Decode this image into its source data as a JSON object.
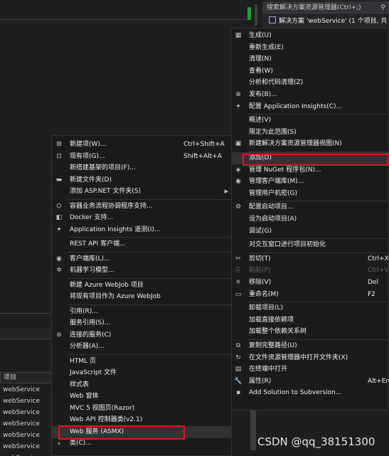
{
  "solution_explorer": {
    "search_placeholder": "搜索解决方案资源管理器(Ctrl+;)",
    "search_icon": "search-icon",
    "solution_label": "解决方案 'webService' (1 个项目, 共"
  },
  "grid": {
    "header": "项目",
    "rows": [
      "webService",
      "webService",
      "webService",
      "webService",
      "webService",
      "webService",
      "webService"
    ]
  },
  "right_menu": {
    "items": [
      {
        "icon": "▦",
        "label": "生成(U)",
        "shortcut": ""
      },
      {
        "icon": "",
        "label": "重新生成(E)",
        "shortcut": ""
      },
      {
        "icon": "",
        "label": "清理(N)",
        "shortcut": ""
      },
      {
        "icon": "",
        "label": "查看(W)",
        "shortcut": ""
      },
      {
        "icon": "",
        "label": "分析和代码清理(Z)",
        "shortcut": ""
      },
      {
        "icon": "⊕",
        "label": "发布(B)...",
        "shortcut": ""
      },
      {
        "icon": "✦",
        "label": "配置 Application Insights(C)...",
        "shortcut": ""
      },
      {
        "icon": "",
        "label": "概述(V)",
        "shortcut": ""
      },
      {
        "icon": "",
        "label": "限定为此范围(S)",
        "shortcut": ""
      },
      {
        "icon": "▣",
        "label": "新建解决方案资源管理器视图(N)",
        "shortcut": ""
      },
      {
        "icon": "",
        "label": "添加(D)",
        "shortcut": ""
      },
      {
        "icon": "◈",
        "label": "管理 NuGet 程序包(N)...",
        "shortcut": ""
      },
      {
        "icon": "◉",
        "label": "管理客户端库(M)...",
        "shortcut": ""
      },
      {
        "icon": "",
        "label": "管理用户机密(G)",
        "shortcut": ""
      },
      {
        "icon": "⚙",
        "label": "配置启动项目...",
        "shortcut": ""
      },
      {
        "icon": "",
        "label": "设为启动项目(A)",
        "shortcut": ""
      },
      {
        "icon": "",
        "label": "调试(G)",
        "shortcut": ""
      },
      {
        "icon": "",
        "label": "对交互窗口进行项目初始化",
        "shortcut": ""
      },
      {
        "icon": "✂",
        "label": "剪切(T)",
        "shortcut": "Ctrl+X"
      },
      {
        "icon": "⎘",
        "label": "粘贴(P)",
        "shortcut": "Ctrl+V"
      },
      {
        "icon": "✕",
        "label": "移除(V)",
        "shortcut": "Del"
      },
      {
        "icon": "▭",
        "label": "重命名(M)",
        "shortcut": "F2"
      },
      {
        "icon": "",
        "label": "卸载项目(L)",
        "shortcut": ""
      },
      {
        "icon": "",
        "label": "加载直接依赖项",
        "shortcut": ""
      },
      {
        "icon": "",
        "label": "加载整个依赖关系树",
        "shortcut": ""
      },
      {
        "icon": "⧉",
        "label": "复制完整路径(U)",
        "shortcut": ""
      },
      {
        "icon": "↻",
        "label": "在文件资源管理器中打开文件夹(X)",
        "shortcut": ""
      },
      {
        "icon": "▤",
        "label": "在终端中打开",
        "shortcut": ""
      },
      {
        "icon": "🔧",
        "label": "属性(R)",
        "shortcut": "Alt+Ent"
      },
      {
        "icon": "▪",
        "label": "Add Solution to Subversion...",
        "shortcut": ""
      }
    ]
  },
  "add_submenu": {
    "items": [
      {
        "icon": "⊞",
        "label": "新建项(W)...",
        "shortcut": "Ctrl+Shift+A"
      },
      {
        "icon": "⊡",
        "label": "现有项(G)...",
        "shortcut": "Shift+Alt+A"
      },
      {
        "icon": "",
        "label": "新搭建基架的项目(F)...",
        "shortcut": ""
      },
      {
        "icon": "▬",
        "label": "新建文件夹(D)",
        "shortcut": ""
      },
      {
        "icon": "",
        "label": "添加 ASP.NET 文件夹(S)",
        "shortcut": ""
      },
      {
        "icon": "⛭",
        "label": "容器业务流程协调程序支持...",
        "shortcut": ""
      },
      {
        "icon": "◧",
        "label": "Docker 支持...",
        "shortcut": ""
      },
      {
        "icon": "✦",
        "label": "Application Insights 遥测(I)...",
        "shortcut": ""
      },
      {
        "icon": "",
        "label": "REST API 客户端...",
        "shortcut": ""
      },
      {
        "icon": "◉",
        "label": "客户端库(L)...",
        "shortcut": ""
      },
      {
        "icon": "✲",
        "label": "机器学习模型...",
        "shortcut": ""
      },
      {
        "icon": "",
        "label": "新建 Azure WebJob 项目",
        "shortcut": ""
      },
      {
        "icon": "",
        "label": "将现有项目作为 Azure WebJob",
        "shortcut": ""
      },
      {
        "icon": "",
        "label": "引用(R)...",
        "shortcut": ""
      },
      {
        "icon": "",
        "label": "服务引用(S)...",
        "shortcut": ""
      },
      {
        "icon": "⊛",
        "label": "连接的服务(C)",
        "shortcut": ""
      },
      {
        "icon": "",
        "label": "分析器(A)...",
        "shortcut": ""
      },
      {
        "icon": "",
        "label": "HTML 页",
        "shortcut": ""
      },
      {
        "icon": "",
        "label": "JavaScript 文件",
        "shortcut": ""
      },
      {
        "icon": "",
        "label": "样式表",
        "shortcut": ""
      },
      {
        "icon": "",
        "label": "Web 窗体",
        "shortcut": ""
      },
      {
        "icon": "",
        "label": "MVC 5 视图页(Razor)",
        "shortcut": ""
      },
      {
        "icon": "",
        "label": "Web API 控制器类(v2.1)",
        "shortcut": ""
      },
      {
        "icon": "",
        "label": "Web 服务 (ASMX)",
        "shortcut": ""
      },
      {
        "icon": "⁎",
        "label": "类(C)...",
        "shortcut": ""
      }
    ]
  },
  "watermark": "CSDN @qq_38151300"
}
